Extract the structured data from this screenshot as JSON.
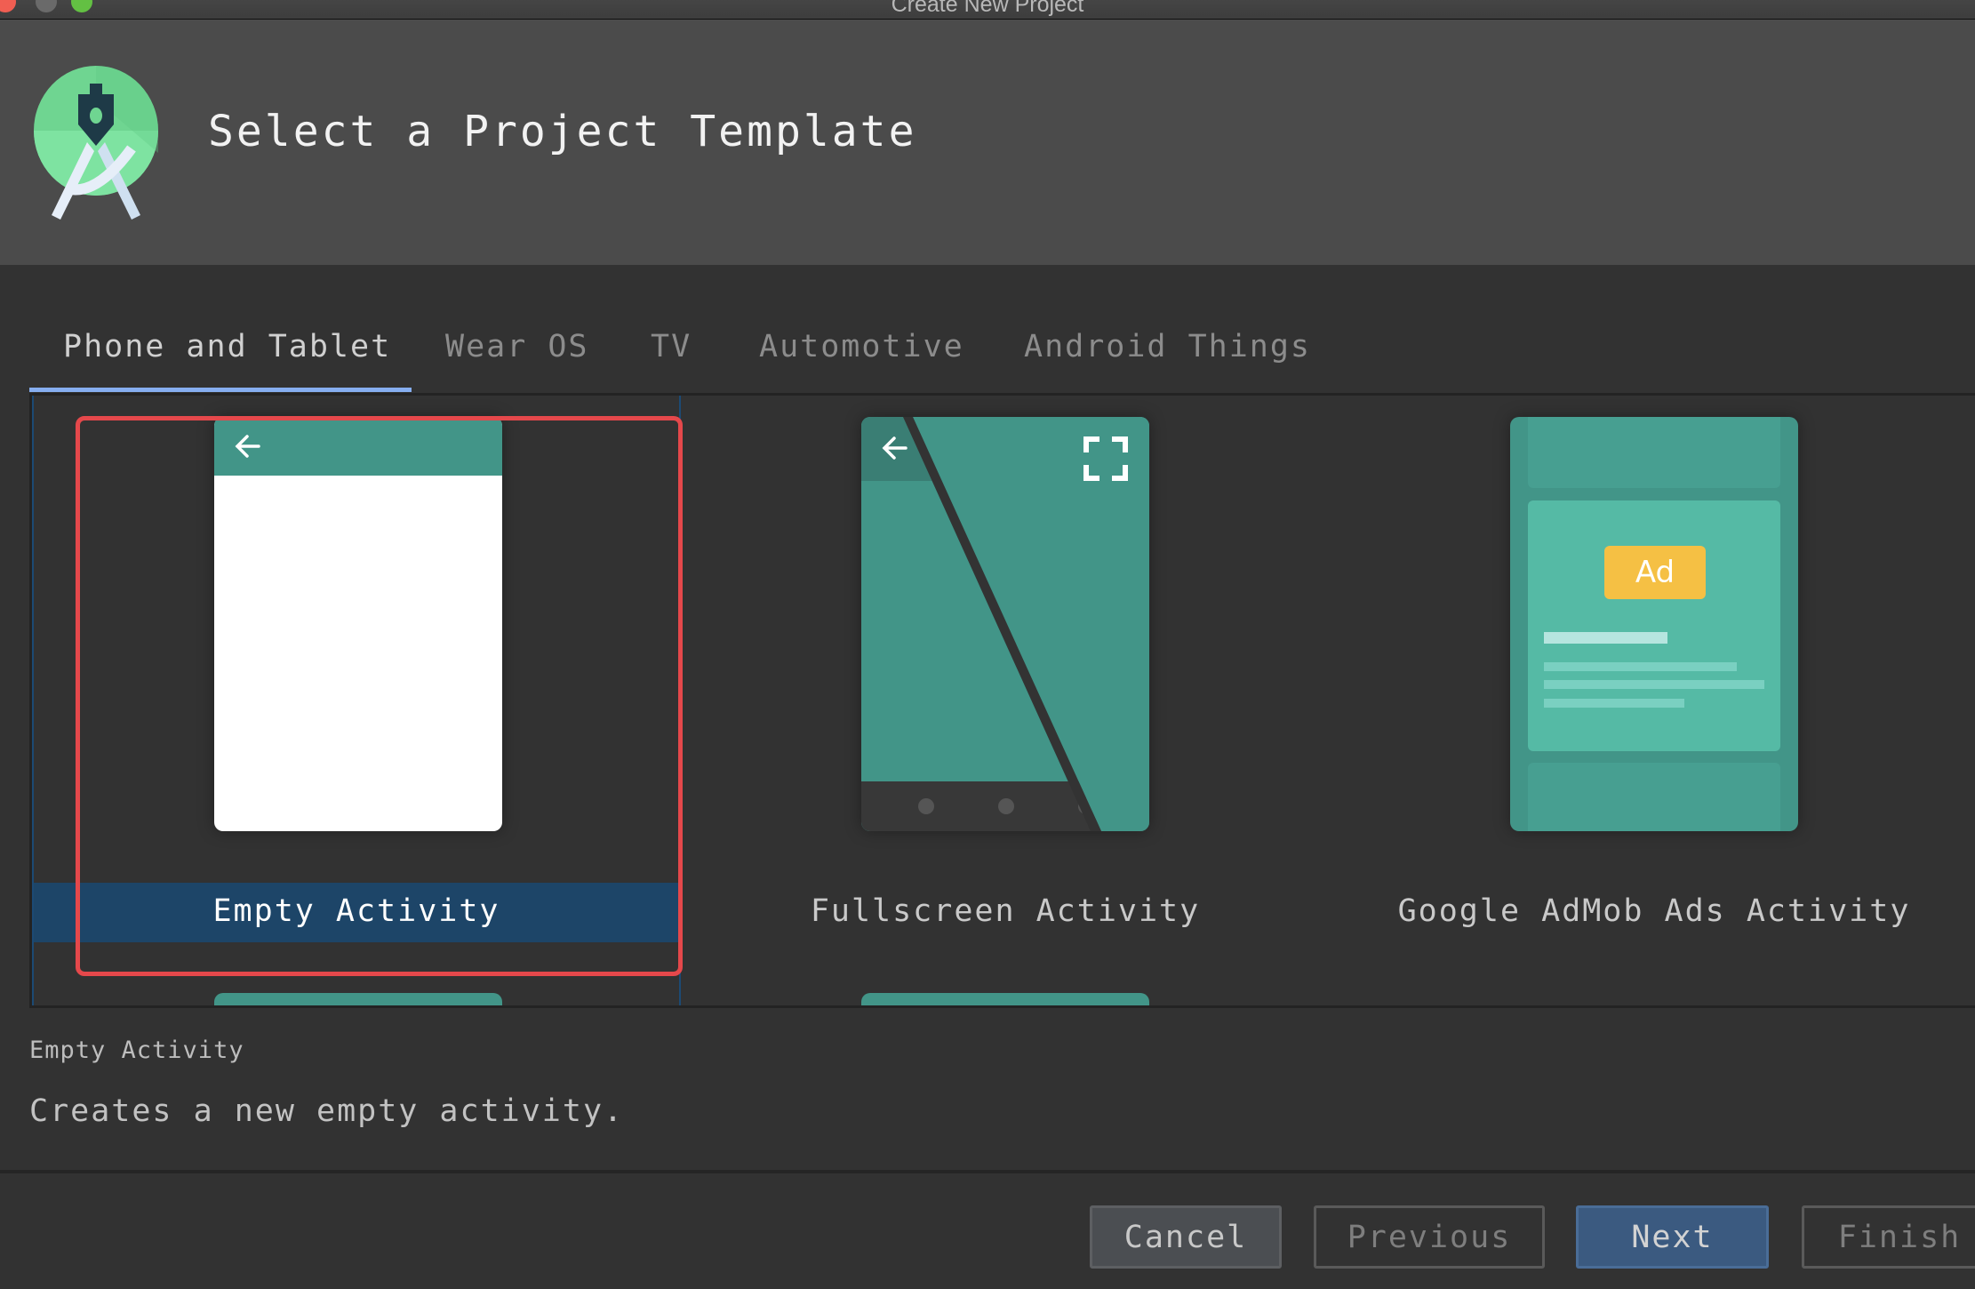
{
  "window": {
    "title": "Create New Project",
    "controls": [
      "close",
      "minimize",
      "maximize"
    ]
  },
  "header": {
    "logo_icon": "android-studio-logo-icon",
    "title": "Select a Project Template"
  },
  "tabs": [
    {
      "label": "Phone and Tablet",
      "active": true
    },
    {
      "label": "Wear OS",
      "active": false
    },
    {
      "label": "TV",
      "active": false
    },
    {
      "label": "Automotive",
      "active": false
    },
    {
      "label": "Android Things",
      "active": false
    }
  ],
  "templates": [
    {
      "label": "Empty Activity",
      "selected": true,
      "thumbnail": "empty-activity-thumbnail"
    },
    {
      "label": "Fullscreen Activity",
      "selected": false,
      "thumbnail": "fullscreen-activity-thumbnail"
    },
    {
      "label": "Google AdMob Ads Activity",
      "selected": false,
      "thumbnail": "admob-activity-thumbnail",
      "badge": "Ad"
    }
  ],
  "description": {
    "title": "Empty Activity",
    "text": "Creates a new empty activity."
  },
  "buttons": {
    "cancel": "Cancel",
    "previous": "Previous",
    "next": "Next",
    "finish": "Finish"
  },
  "colors": {
    "accent_tab_underline": "#86aef0",
    "selection_band": "#1d4568",
    "highlight_border": "#e5484b",
    "thumbnail_teal": "#429588",
    "ad_badge": "#f5c044",
    "primary_button": "#3b5a80"
  }
}
